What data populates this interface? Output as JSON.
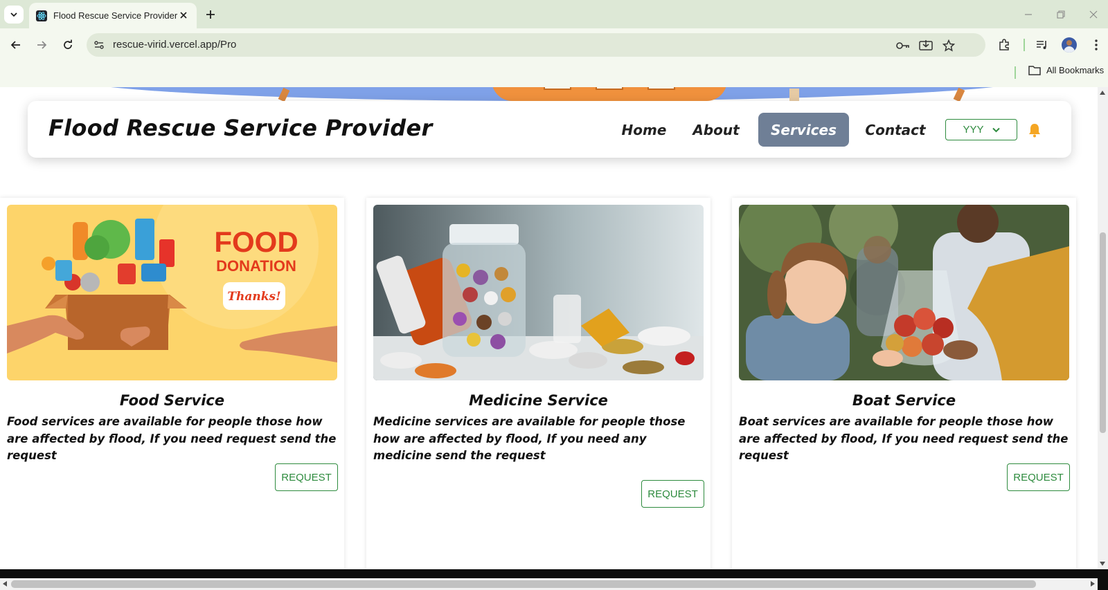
{
  "browser": {
    "tab_title": "Flood Rescue Service Provider",
    "url": "rescue-virid.vercel.app/Pro",
    "bookmarks_label": "All Bookmarks"
  },
  "navbar": {
    "brand": "Flood Rescue Service Provider",
    "links": [
      {
        "label": "Home",
        "active": false
      },
      {
        "label": "About",
        "active": false
      },
      {
        "label": "Services",
        "active": true
      },
      {
        "label": "Contact",
        "active": false
      }
    ],
    "language_selected": "YYY"
  },
  "services": [
    {
      "title": "Food Service",
      "description": "Food services are available for people those how are affected by flood, If you need request send the request",
      "button": "REQUEST",
      "image_text": {
        "line1": "FOOD",
        "line2": "DONATION",
        "note": "Thanks!"
      }
    },
    {
      "title": "Medicine Service",
      "description": "Medicine services are available for people those how are affected by flood, If you need any medicine send the request",
      "button": "REQUEST"
    },
    {
      "title": "Boat Service",
      "description": "Boat services are available for people those how are affected by flood, If you need request send the request",
      "button": "REQUEST"
    }
  ],
  "colors": {
    "accent_green": "#2e8b3e",
    "active_nav": "#6f7f96",
    "bell": "#f5a623",
    "chrome_bg": "#dde8d6"
  }
}
